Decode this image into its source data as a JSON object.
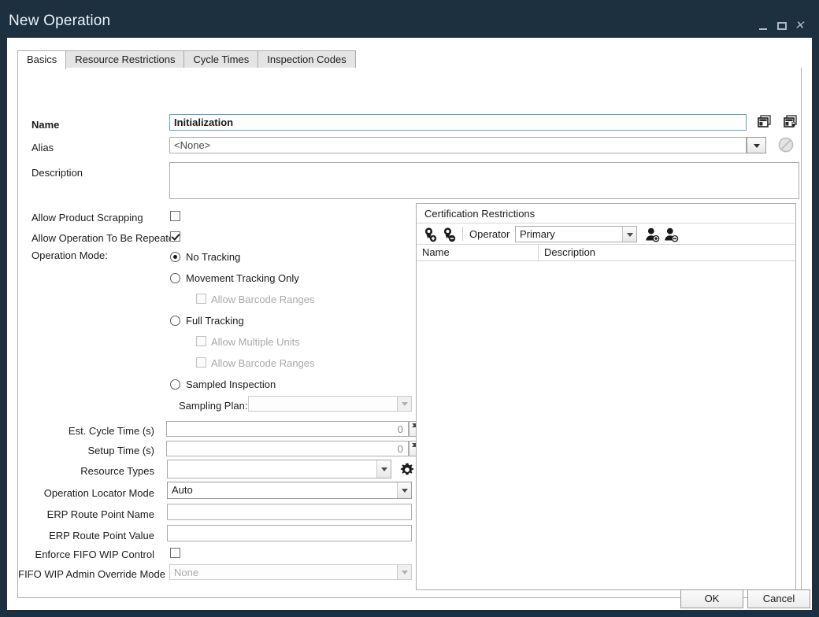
{
  "window": {
    "title": "New Operation",
    "controls": {
      "minimize": "–",
      "maximize": "▢",
      "close": "✕"
    }
  },
  "tabs": [
    {
      "label": "Basics",
      "active": true
    },
    {
      "label": "Resource Restrictions",
      "active": false
    },
    {
      "label": "Cycle Times",
      "active": false
    },
    {
      "label": "Inspection Codes",
      "active": false
    }
  ],
  "form": {
    "name": {
      "label": "Name",
      "value": "Initialization"
    },
    "alias": {
      "label": "Alias",
      "value": "<None>"
    },
    "description": {
      "label": "Description",
      "value": ""
    },
    "allow_product_scrapping": {
      "label": "Allow Product Scrapping",
      "checked": false
    },
    "allow_operation_repeated": {
      "label": "Allow Operation To Be Repeated",
      "checked": true
    },
    "operation_mode": {
      "label": "Operation Mode:",
      "selected": "No Tracking",
      "options": [
        {
          "label": "No Tracking",
          "selected": true
        },
        {
          "label": "Movement Tracking Only",
          "selected": false
        },
        {
          "label": "Full Tracking",
          "selected": false
        },
        {
          "label": "Sampled Inspection",
          "selected": false
        }
      ],
      "sub_movement": [
        {
          "label": "Allow Barcode Ranges",
          "checked": false,
          "enabled": false
        }
      ],
      "sub_full": [
        {
          "label": "Allow Multiple Units",
          "checked": false,
          "enabled": false
        },
        {
          "label": "Allow Barcode Ranges",
          "checked": false,
          "enabled": false
        }
      ]
    },
    "sampling_plan": {
      "label": "Sampling Plan:",
      "value": "",
      "enabled": false
    },
    "est_cycle_time": {
      "label": "Est. Cycle Time  (s)",
      "value": "0"
    },
    "setup_time": {
      "label": "Setup Time (s)",
      "value": "0"
    },
    "resource_types": {
      "label": "Resource Types",
      "value": ""
    },
    "operation_locator_mode": {
      "label": "Operation Locator Mode",
      "value": "Auto"
    },
    "erp_route_point_name": {
      "label": "ERP Route Point Name",
      "value": ""
    },
    "erp_route_point_value": {
      "label": "ERP Route Point Value",
      "value": ""
    },
    "enforce_fifo": {
      "label": "Enforce FIFO WIP Control",
      "checked": false
    },
    "fifo_admin_override": {
      "label": "FIFO WIP Admin Override Mode",
      "value": "None",
      "enabled": false
    }
  },
  "certification": {
    "title": "Certification Restrictions",
    "operator_label": "Operator",
    "operator_value": "Primary",
    "columns": [
      "Name",
      "Description"
    ],
    "rows": []
  },
  "buttons": {
    "ok": "OK",
    "cancel": "Cancel"
  },
  "colors": {
    "titlebar": "#1c3040",
    "accent_focus": "#5ba3c9",
    "panel_border": "#acacac",
    "text": "#1b1b1b",
    "disabled_text": "#a9a9a9"
  }
}
